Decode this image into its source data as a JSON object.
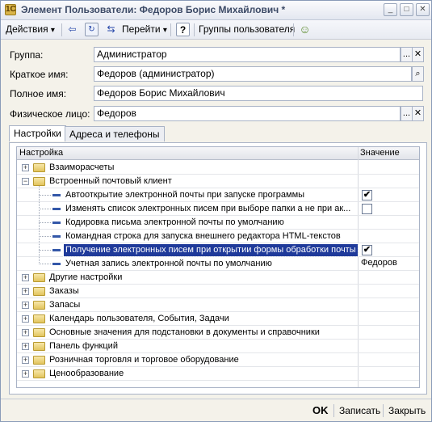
{
  "window": {
    "title": "Элемент Пользователи: Федоров Борис Михайлович *",
    "minimize": "_",
    "maximize": "□",
    "close": "✕"
  },
  "toolbar": {
    "actions_label": "Действия",
    "goto_label": "Перейти",
    "help_label": "?",
    "user_groups_label": "Группы пользователя"
  },
  "form": {
    "group_label": "Группа:",
    "group_value": "Администратор",
    "short_name_label": "Краткое имя:",
    "short_name_value": "Федоров (администратор)",
    "full_name_label": "Полное имя:",
    "full_name_value": "Федоров Борис Михайлович",
    "person_label": "Физическое лицо:",
    "person_value": "Федоров"
  },
  "tabs": [
    {
      "label": "Настройки",
      "active": true
    },
    {
      "label": "Адреса и телефоны",
      "active": false
    }
  ],
  "tree": {
    "col_setting": "Настройка",
    "col_value": "Значение",
    "rows": [
      {
        "label": "Взаиморасчеты",
        "type": "folder",
        "expander": "+",
        "value": ""
      },
      {
        "label": "Встроенный почтовый клиент",
        "type": "folder",
        "expander": "−",
        "value": ""
      },
      {
        "label": "Автооткрытие электронной почты при запуске программы",
        "type": "leaf",
        "checkbox": true,
        "checked": true
      },
      {
        "label": "Изменять список электронных писем при выборе папки а не при ак...",
        "type": "leaf",
        "checkbox": true,
        "checked": false
      },
      {
        "label": "Кодировка письма электронной почты по умолчанию",
        "type": "leaf",
        "value": ""
      },
      {
        "label": "Командная строка для запуска внешнего редактора HTML-текстов",
        "type": "leaf",
        "value": ""
      },
      {
        "label": "Получение электронных писем при открытии формы обработки почты",
        "type": "leaf",
        "checkbox": true,
        "checked": true,
        "selected": true
      },
      {
        "label": "Учетная запись электронной почты по умолчанию",
        "type": "leaf",
        "value": "Федоров"
      },
      {
        "label": "Другие настройки",
        "type": "folder",
        "expander": "+",
        "value": ""
      },
      {
        "label": "Заказы",
        "type": "folder",
        "expander": "+",
        "value": ""
      },
      {
        "label": "Запасы",
        "type": "folder",
        "expander": "+",
        "value": ""
      },
      {
        "label": "Календарь пользователя, События, Задачи",
        "type": "folder",
        "expander": "+",
        "value": ""
      },
      {
        "label": "Основные значения для подстановки в документы и справочники",
        "type": "folder",
        "expander": "+",
        "value": ""
      },
      {
        "label": "Панель функций",
        "type": "folder",
        "expander": "+",
        "value": ""
      },
      {
        "label": "Розничная торговля и торговое оборудование",
        "type": "folder",
        "expander": "+",
        "value": ""
      },
      {
        "label": "Ценообразование",
        "type": "folder",
        "expander": "+",
        "value": ""
      }
    ]
  },
  "footer": {
    "ok_label": "OK",
    "save_label": "Записать",
    "close_label": "Закрыть"
  },
  "glyphs": {
    "dropdown": "▾",
    "ellipsis": "...",
    "clear": "✕",
    "search": "⌕",
    "check": "✔"
  }
}
